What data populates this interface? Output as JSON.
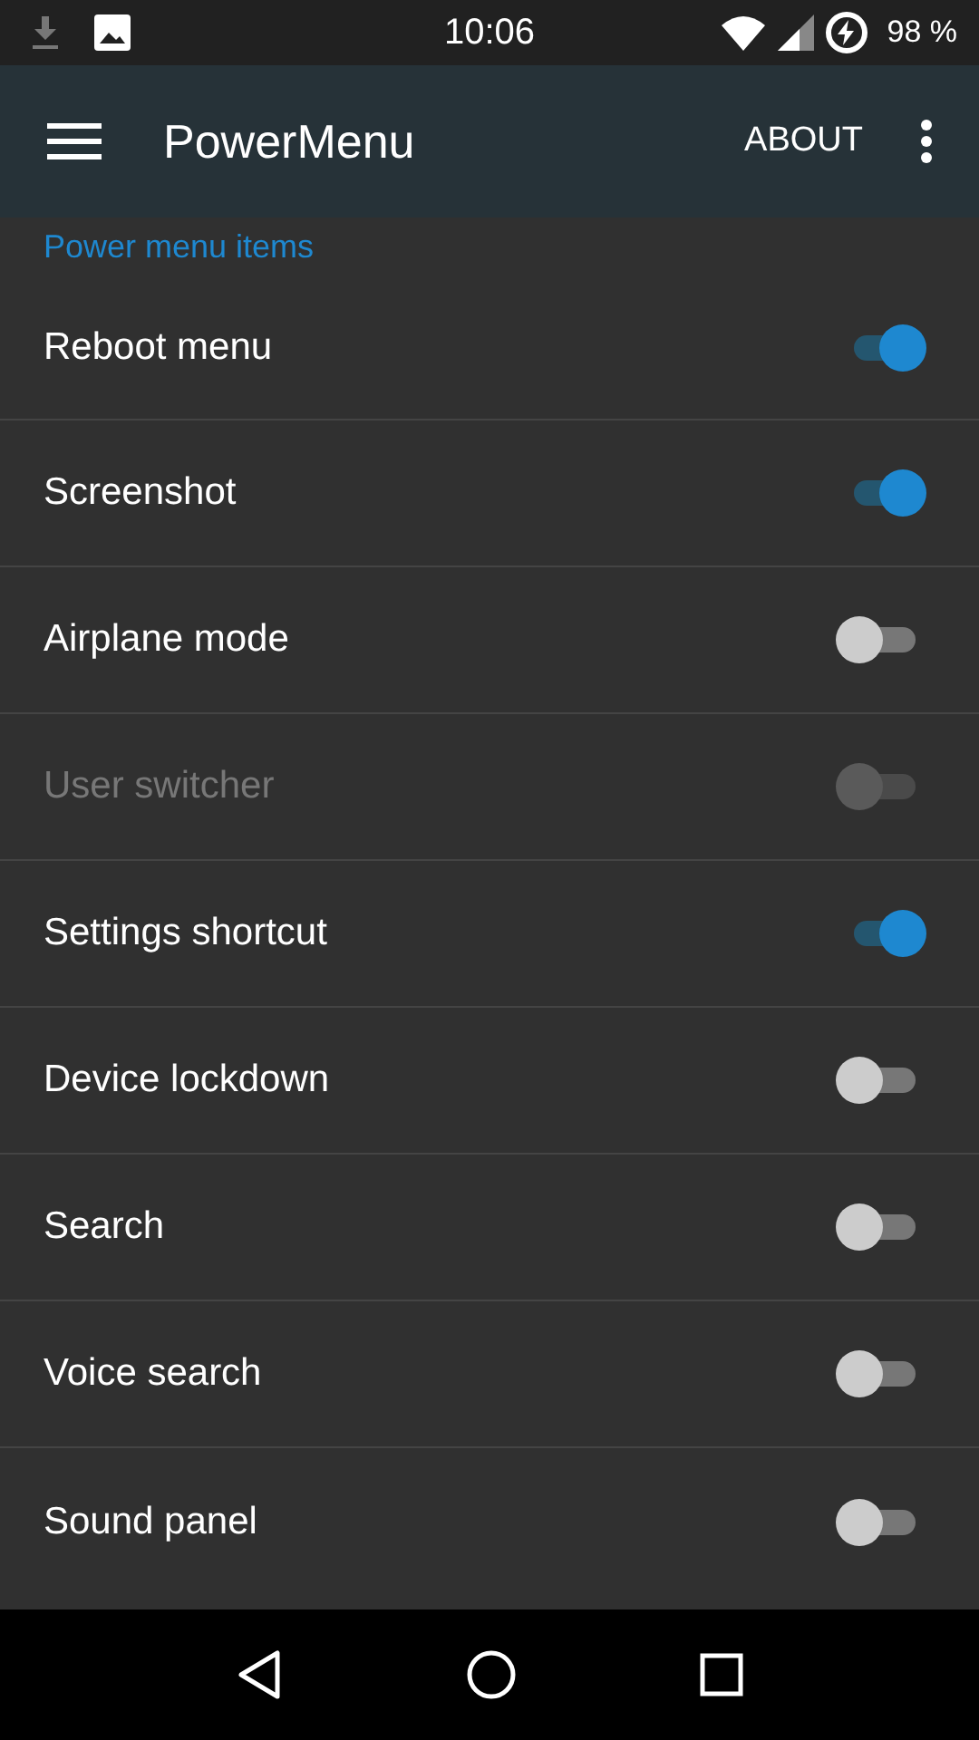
{
  "status_bar": {
    "time": "10:06",
    "battery": "98 %"
  },
  "toolbar": {
    "title": "PowerMenu",
    "action": "ABOUT"
  },
  "section": {
    "title": "Power menu items"
  },
  "items": [
    {
      "label": "Reboot menu",
      "on": true,
      "disabled": false
    },
    {
      "label": "Screenshot",
      "on": true,
      "disabled": false
    },
    {
      "label": "Airplane mode",
      "on": false,
      "disabled": false
    },
    {
      "label": "User switcher",
      "on": false,
      "disabled": true
    },
    {
      "label": "Settings shortcut",
      "on": true,
      "disabled": false
    },
    {
      "label": "Device lockdown",
      "on": false,
      "disabled": false
    },
    {
      "label": "Search",
      "on": false,
      "disabled": false
    },
    {
      "label": "Voice search",
      "on": false,
      "disabled": false
    },
    {
      "label": "Sound panel",
      "on": false,
      "disabled": false
    }
  ]
}
